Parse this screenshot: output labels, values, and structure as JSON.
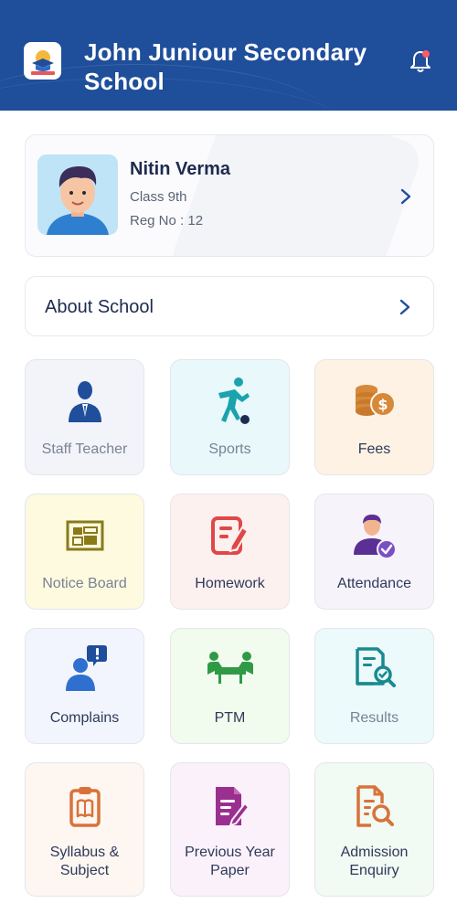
{
  "header": {
    "school_name": "John Juniour Secondary School",
    "logo_text": "EDUCATION",
    "notification_icon": "bell-icon"
  },
  "student": {
    "name": "Nitin Verma",
    "class": "Class 9th",
    "reg_no": "Reg No : 12"
  },
  "about": {
    "label": "About School"
  },
  "tiles": [
    {
      "label": "Staff Teacher",
      "icon": "teacher-icon"
    },
    {
      "label": "Sports",
      "icon": "football-player-icon"
    },
    {
      "label": "Fees",
      "icon": "coins-icon"
    },
    {
      "label": "Notice Board",
      "icon": "notice-board-icon"
    },
    {
      "label": "Homework",
      "icon": "homework-edit-icon"
    },
    {
      "label": "Attendance",
      "icon": "attendance-user-check-icon"
    },
    {
      "label": "Complains",
      "icon": "complain-user-alert-icon"
    },
    {
      "label": "PTM",
      "icon": "meeting-table-icon"
    },
    {
      "label": "Results",
      "icon": "results-report-icon"
    },
    {
      "label": "Syllabus & Subject",
      "icon": "syllabus-clipboard-icon"
    },
    {
      "label": "Previous Year Paper",
      "icon": "paper-document-icon"
    },
    {
      "label": "Admission Enquiry",
      "icon": "enquiry-search-document-icon"
    }
  ],
  "colors": {
    "header_bg": "#1f4e9a",
    "primary_text": "#1d2b4f",
    "accent_red": "#e85a5a"
  }
}
